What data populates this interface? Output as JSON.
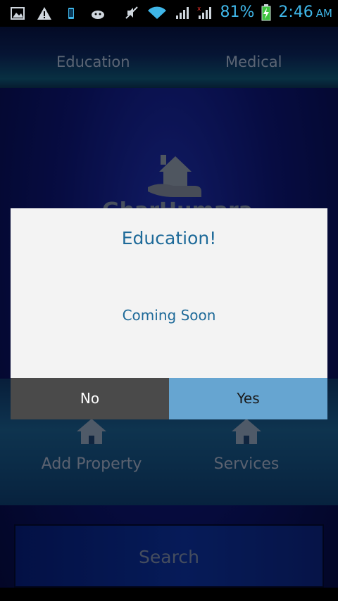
{
  "status_bar": {
    "battery_percent": "81%",
    "time": "2:46",
    "ampm": "AM",
    "icons": [
      "image-icon",
      "warning-icon",
      "phone-icon",
      "android-icon",
      "mute-icon",
      "wifi-icon",
      "signal-icon",
      "signal-x-icon",
      "battery-charging-icon"
    ]
  },
  "nav": {
    "tabs": [
      {
        "label": "Education"
      },
      {
        "label": "Medical"
      }
    ]
  },
  "logo": {
    "text": "GharHumara"
  },
  "grid": {
    "add_property_label": "Add Property",
    "services_label": "Services"
  },
  "search": {
    "label": "Search"
  },
  "dialog": {
    "title": "Education!",
    "message": "Coming Soon",
    "no_label": "No",
    "yes_label": "Yes"
  },
  "colors": {
    "accent": "#1e6a99",
    "yes_button": "#66a5d1",
    "no_button": "#4a4a4a",
    "status_text": "#3fb6e8"
  }
}
